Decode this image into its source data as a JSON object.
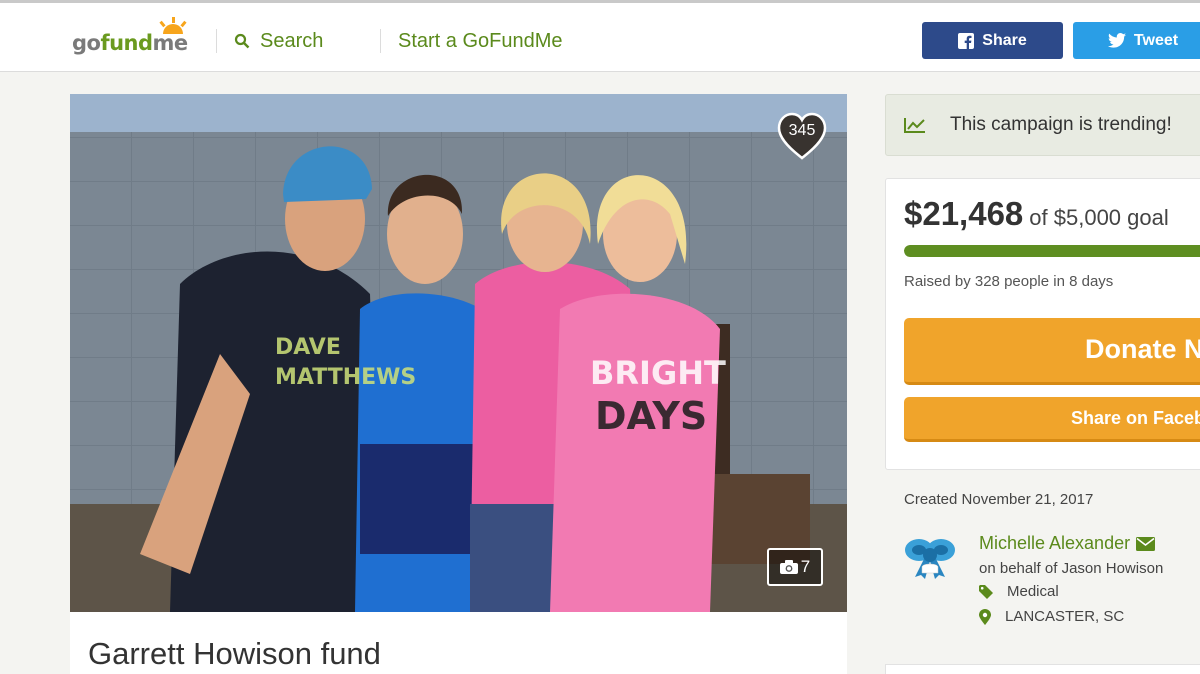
{
  "header": {
    "logo": {
      "go": "go",
      "fund": "fund",
      "me": "me"
    },
    "search_label": "Search",
    "start_label": "Start a GoFundMe",
    "share_label": "Share",
    "tweet_label": "Tweet"
  },
  "colors": {
    "brand_green": "#5b8a1c",
    "facebook_blue": "#2d4a8a",
    "twitter_blue": "#2a9ee6",
    "donate_orange": "#f0a42b"
  },
  "campaign": {
    "title": "Garrett Howison fund",
    "hearts": "345",
    "photo_count": "7",
    "trending": "This campaign is trending!",
    "raised": "$21,468",
    "goal": "of $5,000 goal",
    "progress_fraction": 1.0,
    "raised_by": "Raised by 328 people in 8 days",
    "donate_label": "Donate Now",
    "share_facebook_label": "Share on Facebook",
    "created": "Created November 21, 2017"
  },
  "organizer": {
    "name": "Michelle Alexander",
    "behalf": "on behalf of Jason Howison",
    "category": "Medical",
    "location": "LANCASTER, SC"
  },
  "icons": {
    "search": "search-icon",
    "facebook": "facebook-icon",
    "twitter": "twitter-icon",
    "heart": "heart-icon",
    "camera": "camera-icon",
    "trending": "trending-icon",
    "email": "email-icon",
    "tag": "tag-icon",
    "location": "location-pin-icon"
  }
}
